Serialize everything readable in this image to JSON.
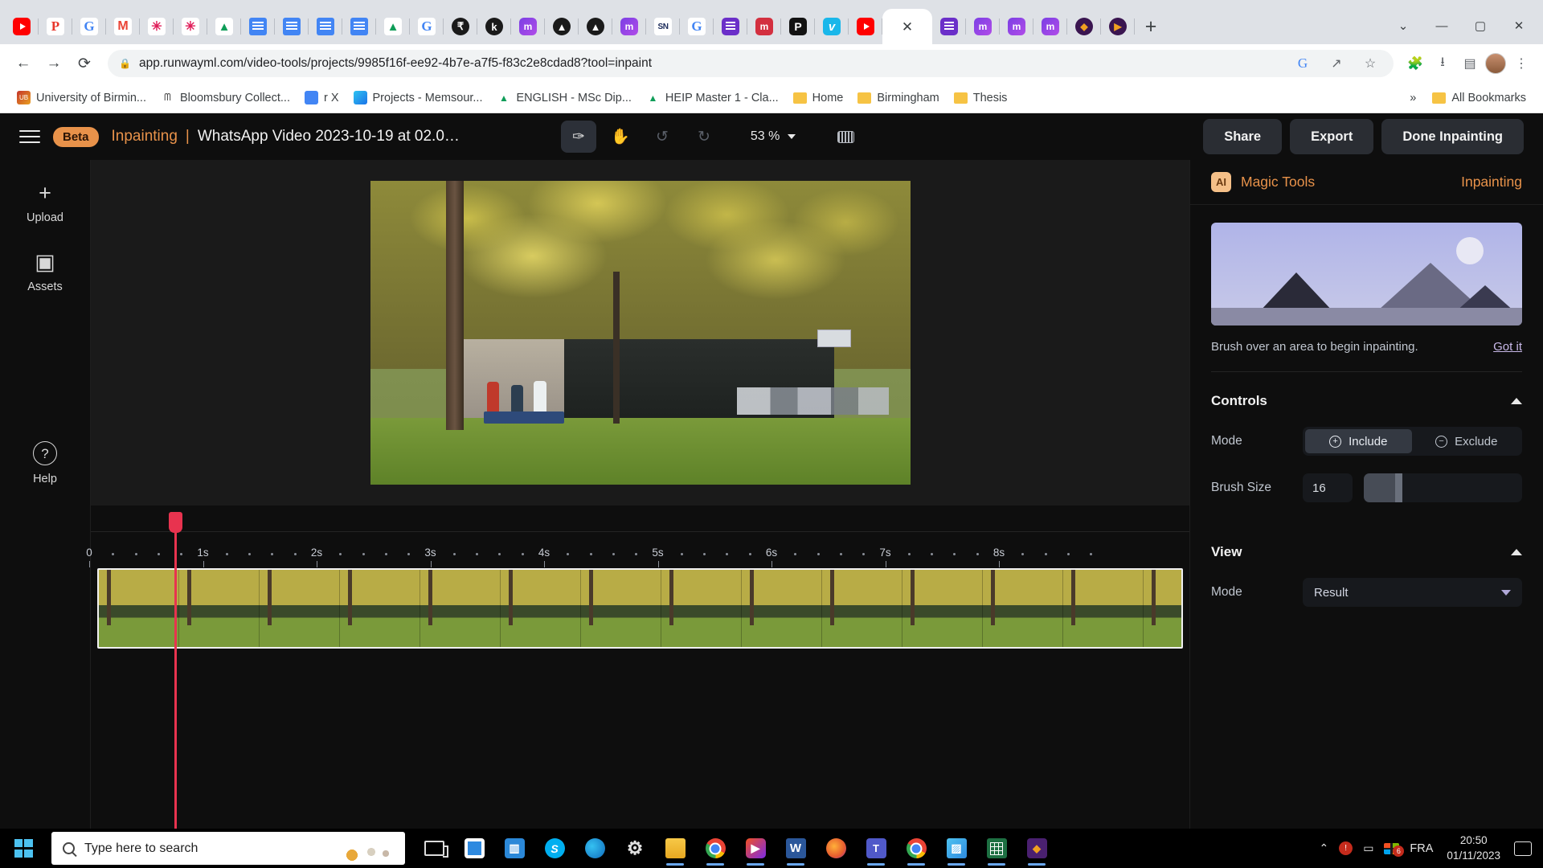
{
  "browser": {
    "pinned_tabs": [
      {
        "name": "youtube",
        "cls": "fi-yt",
        "glyph": ""
      },
      {
        "name": "pdf",
        "cls": "fi-pdf",
        "glyph": "P"
      },
      {
        "name": "google",
        "cls": "fi-google",
        "glyph": "G"
      },
      {
        "name": "gmail",
        "cls": "fi-gmail",
        "glyph": "M"
      },
      {
        "name": "slack",
        "cls": "fi-slack",
        "glyph": "✳"
      },
      {
        "name": "slack",
        "cls": "fi-slack",
        "glyph": "✳"
      },
      {
        "name": "google-drive",
        "cls": "fi-drive",
        "glyph": "▲"
      },
      {
        "name": "google-docs",
        "cls": "fi-docs",
        "glyph": ""
      },
      {
        "name": "google-docs",
        "cls": "fi-docs",
        "glyph": ""
      },
      {
        "name": "google-docs",
        "cls": "fi-docs",
        "glyph": ""
      },
      {
        "name": "google-docs",
        "cls": "fi-docs",
        "glyph": ""
      },
      {
        "name": "google-drive",
        "cls": "fi-drive",
        "glyph": "▲"
      },
      {
        "name": "google",
        "cls": "fi-google",
        "glyph": "G"
      },
      {
        "name": "dark-app",
        "cls": "fi-dark",
        "glyph": "₹"
      },
      {
        "name": "kobo",
        "cls": "fi-dark",
        "glyph": "k"
      },
      {
        "name": "mural",
        "cls": "fi-mural",
        "glyph": "m"
      },
      {
        "name": "aconnect",
        "cls": "fi-dark",
        "glyph": "▲"
      },
      {
        "name": "aconnect",
        "cls": "fi-dark",
        "glyph": "▲"
      },
      {
        "name": "mural",
        "cls": "fi-mural",
        "glyph": "m"
      },
      {
        "name": "sciencenotes",
        "cls": "fi-sn",
        "glyph": "SN"
      },
      {
        "name": "google",
        "cls": "fi-google",
        "glyph": "G"
      },
      {
        "name": "notion-list",
        "cls": "fi-list",
        "glyph": ""
      },
      {
        "name": "mural-red",
        "cls": "fi-mred",
        "glyph": "m"
      },
      {
        "name": "peak",
        "cls": "fi-p",
        "glyph": "P"
      },
      {
        "name": "vimeo",
        "cls": "fi-vimeo",
        "glyph": "v"
      },
      {
        "name": "youtube",
        "cls": "fi-yt",
        "glyph": ""
      }
    ],
    "pinned_tabs_after": [
      {
        "name": "notion-list",
        "cls": "fi-list",
        "glyph": ""
      },
      {
        "name": "mural",
        "cls": "fi-mural",
        "glyph": "m"
      },
      {
        "name": "mural",
        "cls": "fi-mural",
        "glyph": "m"
      },
      {
        "name": "mural",
        "cls": "fi-mural",
        "glyph": "m"
      },
      {
        "name": "canva",
        "cls": "fi-purp2",
        "glyph": "◆"
      },
      {
        "name": "runway",
        "cls": "fi-purp2",
        "glyph": "▶"
      }
    ],
    "tab_close_glyph": "✕",
    "newtab_glyph": "+",
    "window_controls": {
      "minimize": "—",
      "maximize": "▢",
      "close": "✕",
      "chevron": "⌄"
    },
    "nav": {
      "back": "←",
      "forward": "→",
      "reload": "⟳"
    },
    "address": {
      "lock_icon": "lock-icon",
      "url": "app.runwayml.com/video-tools/projects/9985f16f-ee92-4b7e-a7f5-f83c2e8cdad8?tool=inpaint"
    },
    "omni_icons": [
      {
        "name": "google-lens-icon",
        "glyph": "G"
      },
      {
        "name": "share-icon",
        "glyph": "↗"
      },
      {
        "name": "bookmark-star-icon",
        "glyph": "☆"
      }
    ],
    "toolbar_icons": [
      {
        "name": "extensions-icon",
        "glyph": "🧩"
      },
      {
        "name": "downloads-icon",
        "glyph": "⭳"
      },
      {
        "name": "side-panel-icon",
        "glyph": "▤"
      }
    ],
    "menu_glyph": "⋮",
    "bookmarks": [
      {
        "label": "University of Birmin...",
        "icon": "bm-uob",
        "glyph": "UB",
        "type": "site"
      },
      {
        "label": "Bloomsbury Collect...",
        "icon": "bm-bloom",
        "glyph": "ᗰ",
        "type": "site"
      },
      {
        "label": "r X",
        "icon": "bm-rx",
        "glyph": "",
        "type": "site"
      },
      {
        "label": "Projects - Memsour...",
        "icon": "bm-mem",
        "glyph": "",
        "type": "site"
      },
      {
        "label": "ENGLISH - MSc Dip...",
        "icon": "bm-drv",
        "glyph": "▲",
        "type": "site"
      },
      {
        "label": "HEIP Master 1 - Cla...",
        "icon": "bm-drv",
        "glyph": "▲",
        "type": "site"
      },
      {
        "label": "Home",
        "icon": "",
        "glyph": "",
        "type": "folder"
      },
      {
        "label": "Birmingham",
        "icon": "",
        "glyph": "",
        "type": "folder"
      },
      {
        "label": "Thesis",
        "icon": "",
        "glyph": "",
        "type": "folder"
      }
    ],
    "overflow_glyph": "»",
    "all_bookmarks_label": "All Bookmarks"
  },
  "app": {
    "menu_icon": "hamburger-menu-icon",
    "beta_badge": "Beta",
    "tool_name": "Inpainting",
    "title_separator": "|",
    "project_title": "WhatsApp Video 2023-10-19 at 02.0…",
    "tools": [
      {
        "name": "brush-tool",
        "glyph": "✑",
        "active": true
      },
      {
        "name": "hand-tool",
        "glyph": "✋",
        "active": false
      },
      {
        "name": "undo-button",
        "glyph": "↺",
        "active": false,
        "disabled": true
      },
      {
        "name": "redo-button",
        "glyph": "↻",
        "active": false,
        "disabled": true
      }
    ],
    "zoom_level": "53 %",
    "keyboard_shortcuts_icon": "keyboard-icon",
    "header_buttons": [
      {
        "name": "share-button",
        "label": "Share"
      },
      {
        "name": "export-button",
        "label": "Export"
      },
      {
        "name": "done-inpainting-button",
        "label": "Done Inpainting"
      }
    ],
    "sidebar": [
      {
        "name": "upload",
        "label": "Upload",
        "glyph": "+"
      },
      {
        "name": "assets",
        "label": "Assets",
        "glyph": "▣"
      }
    ],
    "sidebar_bottom": {
      "name": "help",
      "label": "Help",
      "glyph": "?"
    },
    "timeline": {
      "ticks": [
        "0",
        "1s",
        "2s",
        "3s",
        "4s",
        "5s",
        "6s",
        "7s",
        "8s"
      ],
      "playhead_label": "playhead"
    }
  },
  "panel": {
    "ai_badge": "AI",
    "title": "Magic Tools",
    "mode_label": "Inpainting",
    "promo_caption": "Brush over an area to begin inpainting.",
    "promo_link": "Got it",
    "controls": {
      "heading": "Controls",
      "mode_label": "Mode",
      "include_label": "Include",
      "include_glyph": "+",
      "exclude_label": "Exclude",
      "exclude_glyph": "−",
      "brush_size_label": "Brush Size",
      "brush_size_value": "16"
    },
    "view": {
      "heading": "View",
      "mode_label": "Mode",
      "mode_value": "Result"
    }
  },
  "taskbar": {
    "start_name": "start-button",
    "search_placeholder": "Type here to search",
    "apps": [
      {
        "name": "task-view",
        "cls": "tbi-task",
        "glyph": "",
        "running": false
      },
      {
        "name": "microsoft-store",
        "cls": "tbi-store",
        "glyph": "▦",
        "running": false
      },
      {
        "name": "windows-app",
        "cls": "tbi-win11",
        "glyph": "▥",
        "running": false
      },
      {
        "name": "skype",
        "cls": "tbi-skype",
        "glyph": "S",
        "running": false
      },
      {
        "name": "microsoft-edge",
        "cls": "tbi-edge",
        "glyph": "",
        "running": false
      },
      {
        "name": "settings",
        "cls": "tbi-gear",
        "glyph": "⚙",
        "running": false
      },
      {
        "name": "file-explorer",
        "cls": "tbi-folder",
        "glyph": "",
        "running": true
      },
      {
        "name": "google-chrome",
        "cls": "tbi-chrome",
        "glyph": "",
        "running": true
      },
      {
        "name": "play-store",
        "cls": "tbi-play",
        "glyph": "▶",
        "running": true
      },
      {
        "name": "microsoft-word",
        "cls": "tbi-word",
        "glyph": "W",
        "running": true
      },
      {
        "name": "firefox",
        "cls": "tbi-ff",
        "glyph": "",
        "running": false
      },
      {
        "name": "microsoft-teams",
        "cls": "tbi-teams",
        "glyph": "T",
        "running": true
      },
      {
        "name": "chrome-second",
        "cls": "tbi-chrome",
        "glyph": "",
        "running": true
      },
      {
        "name": "photos",
        "cls": "tbi-photos",
        "glyph": "▨",
        "running": true
      },
      {
        "name": "excel",
        "cls": "tbi-excel",
        "glyph": "",
        "running": true
      },
      {
        "name": "runway-app",
        "cls": "tbi-rw",
        "glyph": "◆",
        "running": true
      }
    ],
    "tray": {
      "chevron": "⌃",
      "notification_badge": "6",
      "language": "FRA",
      "time": "20:50",
      "date": "01/11/2023",
      "action_center": "action-center-icon"
    }
  }
}
